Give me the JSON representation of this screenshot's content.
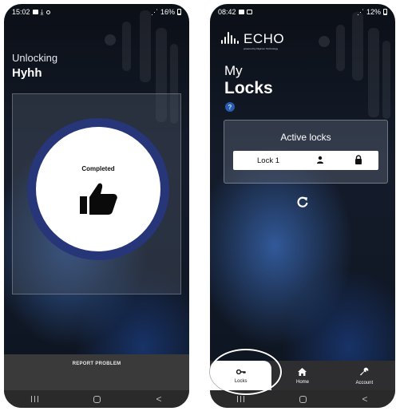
{
  "left_screen": {
    "status": {
      "time": "15:02",
      "battery": "16%"
    },
    "unlocking_label": "Unlocking",
    "lock_name": "Hyhh",
    "result_text": "Completed",
    "result_icon": "thumbs-up-icon",
    "report_button": "REPORT PROBLEM",
    "nav": {
      "recent": "|||",
      "home": "○",
      "back": "<"
    }
  },
  "right_screen": {
    "status": {
      "time": "08:42",
      "battery": "12%"
    },
    "logo_text": "ECHO",
    "logo_subtitle": "powered by Digicom Technology",
    "header": {
      "line1": "My",
      "line2": "Locks"
    },
    "help_icon": "?",
    "active_locks": {
      "title": "Active locks",
      "items": [
        {
          "name": "Lock 1",
          "user_icon": "person-icon",
          "status_icon": "lock-icon"
        }
      ]
    },
    "refresh_icon": "refresh-icon",
    "bottom_nav": [
      {
        "label": "Locks",
        "icon": "key-icon",
        "active": true
      },
      {
        "label": "Home",
        "icon": "home-icon",
        "active": false
      },
      {
        "label": "Account",
        "icon": "wrench-icon",
        "active": false
      }
    ],
    "nav": {
      "recent": "|||",
      "home": "○",
      "back": "<"
    }
  },
  "colors": {
    "ring": "#273579",
    "panel_dark": "#3a3a3b",
    "help_blue": "#2a5db0",
    "annotation": "#ffffff"
  }
}
